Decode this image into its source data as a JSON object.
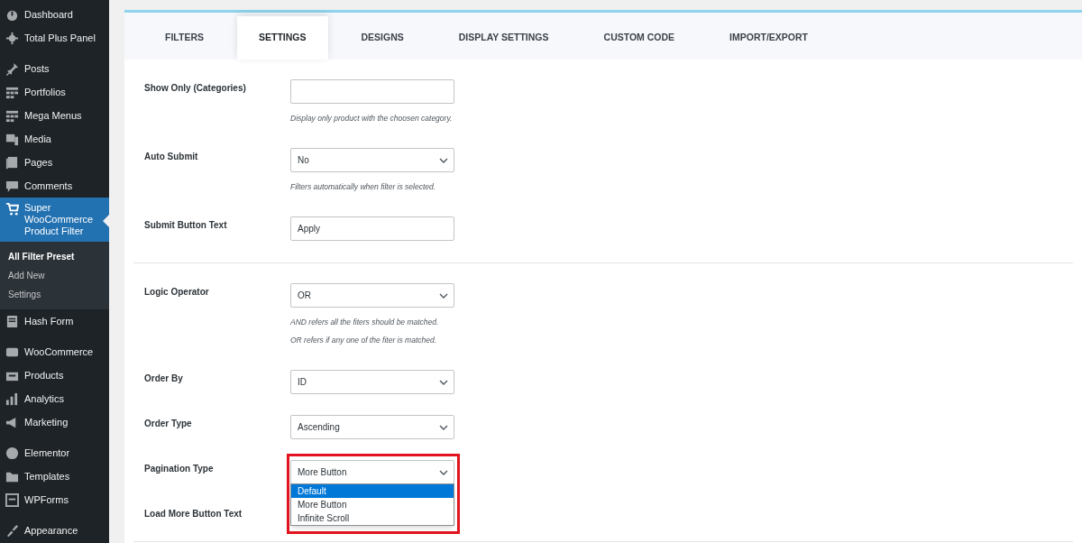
{
  "sidebar": {
    "menu_groups": [
      [
        {
          "label": "Dashboard",
          "selected": false
        },
        {
          "label": "Total Plus Panel",
          "selected": false
        }
      ],
      [
        {
          "label": "Posts",
          "selected": false
        },
        {
          "label": "Portfolios",
          "selected": false
        },
        {
          "label": "Mega Menus",
          "selected": false
        },
        {
          "label": "Media",
          "selected": false
        },
        {
          "label": "Pages",
          "selected": false
        },
        {
          "label": "Comments",
          "selected": false
        },
        {
          "label": "Super WooCommerce Product Filter",
          "selected": true,
          "submenu": [
            {
              "label": "All Filter Preset",
              "selected": true
            },
            {
              "label": "Add New",
              "selected": false
            },
            {
              "label": "Settings",
              "selected": false
            }
          ]
        },
        {
          "label": "Hash Form",
          "selected": false
        }
      ],
      [
        {
          "label": "WooCommerce",
          "selected": false
        },
        {
          "label": "Products",
          "selected": false
        },
        {
          "label": "Analytics",
          "selected": false
        },
        {
          "label": "Marketing",
          "selected": false
        }
      ],
      [
        {
          "label": "Elementor",
          "selected": false
        },
        {
          "label": "Templates",
          "selected": false
        },
        {
          "label": "WPForms",
          "selected": false
        }
      ],
      [
        {
          "label": "Appearance",
          "selected": false
        }
      ]
    ]
  },
  "tabs": [
    {
      "label": "FILTERS",
      "selected": false
    },
    {
      "label": "SETTINGS",
      "selected": true
    },
    {
      "label": "DESIGNS",
      "selected": false
    },
    {
      "label": "DISPLAY SETTINGS",
      "selected": false
    },
    {
      "label": "CUSTOM CODE",
      "selected": false
    },
    {
      "label": "IMPORT/EXPORT",
      "selected": false
    }
  ],
  "sections": [
    {
      "rows": [
        {
          "label": "Show Only (Categories)",
          "kind": "text",
          "help": [
            "Display only product with the choosen category."
          ]
        },
        {
          "label": "Auto Submit",
          "kind": "select",
          "value": "No",
          "help": [
            "Filters automatically when filter is selected."
          ]
        },
        {
          "label": "Submit Button Text",
          "kind": "text",
          "value": "Apply"
        }
      ]
    },
    {
      "rows": [
        {
          "label": "Logic Operator",
          "kind": "select",
          "value": "OR",
          "help": [
            "AND refers all the fiters should be matched.",
            "OR refers if any one of the fiter is matched."
          ]
        },
        {
          "label": "Order By",
          "kind": "select",
          "value": "ID"
        },
        {
          "label": "Order Type",
          "kind": "select",
          "value": "Ascending"
        },
        {
          "label": "Pagination Type",
          "kind": "select",
          "value": "More Button",
          "expanded": true,
          "highlighted": true,
          "options": [
            {
              "label": "Default",
              "highlighted": true
            },
            {
              "label": "More Button",
              "highlighted": false
            },
            {
              "label": "Infinite Scroll",
              "highlighted": false
            }
          ]
        },
        {
          "label": "Load More Button Text",
          "kind": "label_only"
        }
      ]
    }
  ]
}
